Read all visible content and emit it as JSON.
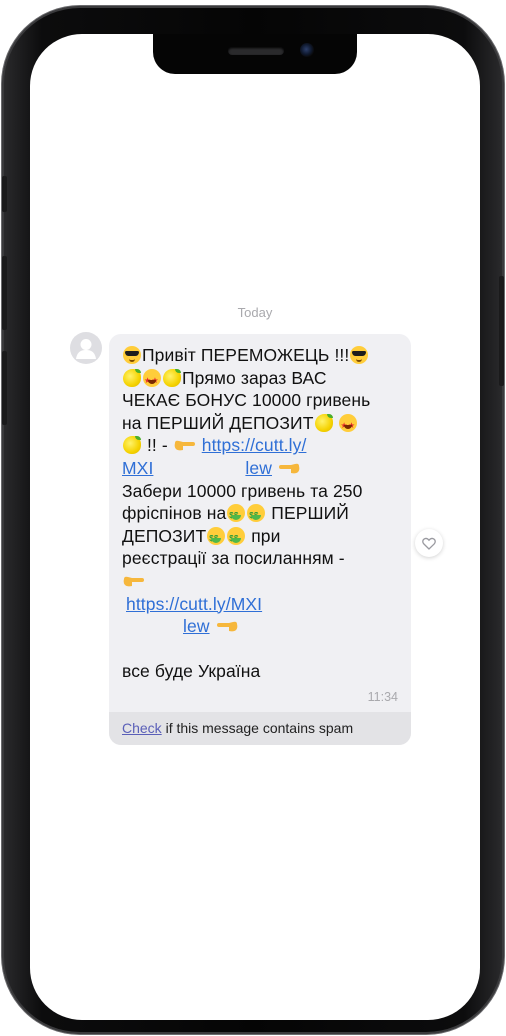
{
  "chat": {
    "date_label": "Today",
    "message": {
      "lines": {
        "l1": "Привіт ПЕРЕМОЖЕЦЬ !!!",
        "l2": "Прямо зараз ВАС",
        "l3": "ЧЕКАЄ БОНУС 10000 гривень",
        "l4": "на ПЕРШИЙ ДЕПОЗИТ",
        "l5_text": "!! -",
        "l5_link": "https://cutt.ly/",
        "l6_link_a": "MXI",
        "l6_link_b": "lew",
        "l7": "Забери 10000 гривень та 250",
        "l8": "фріспінов на",
        "l8_b": "ПЕРШИЙ",
        "l9": "ДЕПОЗИТ",
        "l9_b": "при",
        "l10": "реєстрації за посиланням -",
        "l12_link": "https://cutt.ly/MXI",
        "l13_link": "lew",
        "l15": "все буде Україна"
      },
      "time": "11:34"
    },
    "spam_bar": {
      "check_label": "Check",
      "text": " if this message contains spam"
    }
  },
  "icons": {
    "avatar": "avatar-person-icon",
    "like": "heart-outline-icon",
    "emoji": [
      "smiling-face-with-sunglasses-icon",
      "lemon-icon",
      "star-struck-icon",
      "money-mouth-face-icon",
      "backhand-index-pointing-right-icon",
      "backhand-index-pointing-left-icon"
    ]
  },
  "colors": {
    "bubble": "#f0f0f3",
    "link": "#2f6fd6",
    "spam_check_link": "#5a5fb8",
    "meta_text": "#a9a9ad",
    "frame": "#0a0a0a"
  }
}
